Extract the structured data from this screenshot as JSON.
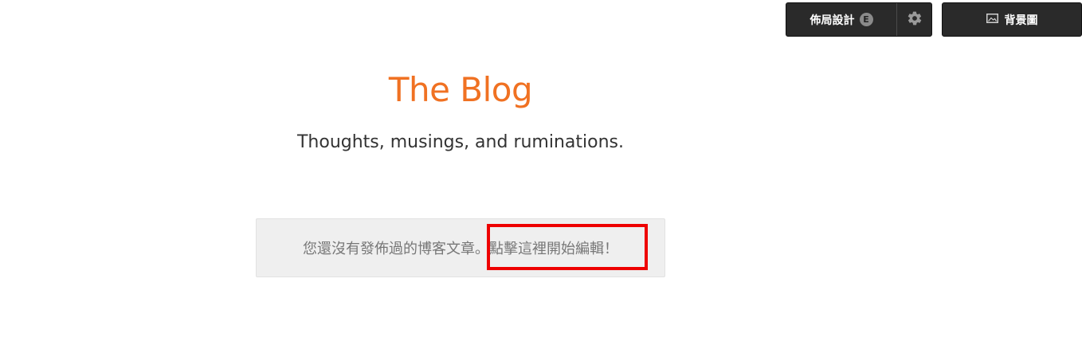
{
  "toolbar": {
    "layout_label": "佈局設計",
    "layout_badge": "E",
    "settings_icon": "gear-icon",
    "background_icon": "image-icon",
    "background_label": "背景圖"
  },
  "blog": {
    "title": "The Blog",
    "tagline": "Thoughts, musings, and ruminations."
  },
  "notice": {
    "text": "您還沒有發佈過的博客文章。",
    "link": "點擊這裡開始編輯！"
  },
  "colors": {
    "title": "#f07122",
    "toolbar_bg": "#2a2a2a",
    "notice_bg": "#efefef",
    "highlight": "#ee0000"
  }
}
